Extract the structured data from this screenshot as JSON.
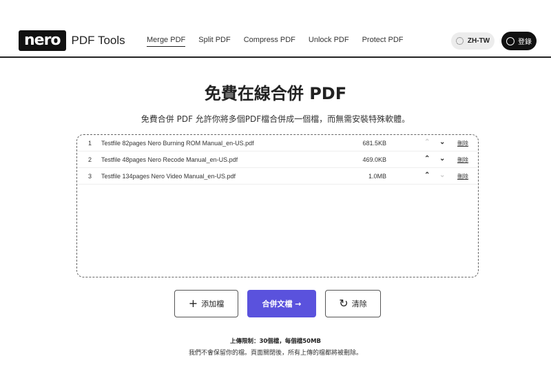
{
  "header": {
    "logo_badge": "nero",
    "logo_text": "PDF Tools",
    "nav": [
      {
        "label": "Merge PDF",
        "active": true
      },
      {
        "label": "Split PDF",
        "active": false
      },
      {
        "label": "Compress PDF",
        "active": false
      },
      {
        "label": "Unlock PDF",
        "active": false
      },
      {
        "label": "Protect PDF",
        "active": false
      }
    ],
    "lang_label": "ZH-TW",
    "login_label": "登錄"
  },
  "main": {
    "title": "免費在線合併 PDF",
    "subtitle": "免費合併 PDF 允許你將多個PDF檔合併成一個檔，而無需安裝特殊軟體。"
  },
  "files": [
    {
      "index": "1",
      "name": "Testfile 82pages Nero Burning ROM Manual_en-US.pdf",
      "size": "681.5KB",
      "delete": "刪除",
      "up_enabled": false,
      "down_enabled": true
    },
    {
      "index": "2",
      "name": "Testfile 48pages Nero Recode Manual_en-US.pdf",
      "size": "469.0KB",
      "delete": "刪除",
      "up_enabled": true,
      "down_enabled": true
    },
    {
      "index": "3",
      "name": "Testfile 134pages Nero Video Manual_en-US.pdf",
      "size": "1.0MB",
      "delete": "刪除",
      "up_enabled": true,
      "down_enabled": false
    }
  ],
  "actions": {
    "add_label": "添加檔",
    "merge_label": "合併文檔 →",
    "clear_label": "清除"
  },
  "footer": {
    "limit_text": "上傳限制：30個檔，每個檔50MB",
    "privacy_text": "我們不會保留你的檔。頁面關閉後，所有上傳的檔都將被刪除。"
  },
  "colors": {
    "accent": "#5a52dd",
    "dark": "#111111"
  },
  "icons": {
    "up": "chevron-up-icon",
    "down": "chevron-down-icon",
    "add": "plus-icon",
    "clear": "refresh-icon",
    "lang": "globe-icon",
    "login": "user-icon"
  }
}
